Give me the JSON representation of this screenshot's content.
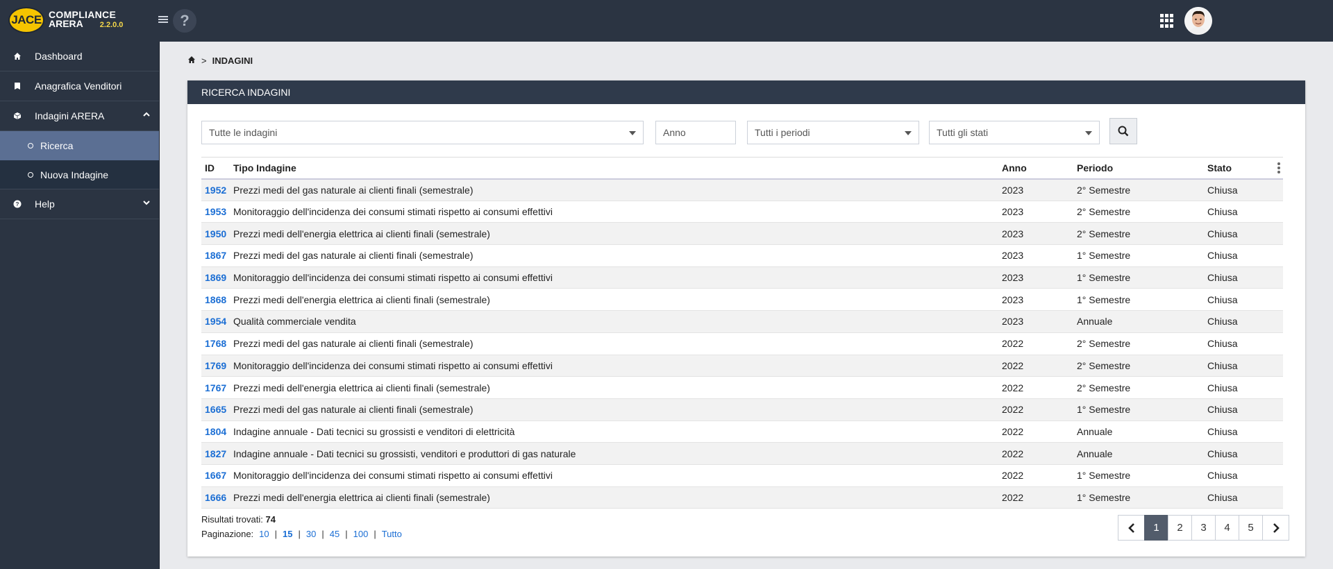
{
  "app": {
    "logo_badge": "JACE",
    "logo_line1": "COMPLIANCE",
    "logo_line2": "ARERA",
    "version": "2.2.0.0"
  },
  "topbar": {
    "help_glyph": "?",
    "menu_icon": "hamburger-icon",
    "apps_icon": "grid-icon"
  },
  "sidebar": {
    "items": [
      {
        "label": "Dashboard",
        "icon": "home-icon"
      },
      {
        "label": "Anagrafica Venditori",
        "icon": "book-icon"
      },
      {
        "label": "Indagini ARERA",
        "icon": "box-icon",
        "expanded": true
      },
      {
        "label": "Help",
        "icon": "question-icon",
        "expanded": false
      }
    ],
    "subitems": [
      {
        "label": "Ricerca",
        "active": true
      },
      {
        "label": "Nuova Indagine",
        "active": false
      }
    ]
  },
  "breadcrumb": {
    "separator": ">",
    "current": "INDAGINI"
  },
  "panel": {
    "title": "RICERCA INDAGINI"
  },
  "filters": {
    "tipo_selected": "Tutte le indagini",
    "anno_placeholder": "Anno",
    "periodo_selected": "Tutti i periodi",
    "stato_selected": "Tutti gli stati"
  },
  "table": {
    "columns": [
      "ID",
      "Tipo Indagine",
      "Anno",
      "Periodo",
      "Stato"
    ],
    "rows": [
      [
        "1952",
        "Prezzi medi del gas naturale ai clienti finali (semestrale)",
        "2023",
        "2° Semestre",
        "Chiusa"
      ],
      [
        "1953",
        "Monitoraggio dell'incidenza dei consumi stimati rispetto ai consumi effettivi",
        "2023",
        "2° Semestre",
        "Chiusa"
      ],
      [
        "1950",
        "Prezzi medi dell'energia elettrica ai clienti finali (semestrale)",
        "2023",
        "2° Semestre",
        "Chiusa"
      ],
      [
        "1867",
        "Prezzi medi del gas naturale ai clienti finali (semestrale)",
        "2023",
        "1° Semestre",
        "Chiusa"
      ],
      [
        "1869",
        "Monitoraggio dell'incidenza dei consumi stimati rispetto ai consumi effettivi",
        "2023",
        "1° Semestre",
        "Chiusa"
      ],
      [
        "1868",
        "Prezzi medi dell'energia elettrica ai clienti finali (semestrale)",
        "2023",
        "1° Semestre",
        "Chiusa"
      ],
      [
        "1954",
        "Qualità commerciale vendita",
        "2023",
        "Annuale",
        "Chiusa"
      ],
      [
        "1768",
        "Prezzi medi del gas naturale ai clienti finali (semestrale)",
        "2022",
        "2° Semestre",
        "Chiusa"
      ],
      [
        "1769",
        "Monitoraggio dell'incidenza dei consumi stimati rispetto ai consumi effettivi",
        "2022",
        "2° Semestre",
        "Chiusa"
      ],
      [
        "1767",
        "Prezzi medi dell'energia elettrica ai clienti finali (semestrale)",
        "2022",
        "2° Semestre",
        "Chiusa"
      ],
      [
        "1665",
        "Prezzi medi del gas naturale ai clienti finali (semestrale)",
        "2022",
        "1° Semestre",
        "Chiusa"
      ],
      [
        "1804",
        "Indagine annuale - Dati tecnici su grossisti e venditori di elettricità",
        "2022",
        "Annuale",
        "Chiusa"
      ],
      [
        "1827",
        "Indagine annuale - Dati tecnici su grossisti, venditori e produttori di gas naturale",
        "2022",
        "Annuale",
        "Chiusa"
      ],
      [
        "1667",
        "Monitoraggio dell'incidenza dei consumi stimati rispetto ai consumi effettivi",
        "2022",
        "1° Semestre",
        "Chiusa"
      ],
      [
        "1666",
        "Prezzi medi dell'energia elettrica ai clienti finali (semestrale)",
        "2022",
        "1° Semestre",
        "Chiusa"
      ]
    ]
  },
  "footer": {
    "results_label": "Risultati trovati:",
    "results_count": "74",
    "pagesize_label": "Paginazione:",
    "pagesize_options": [
      "10",
      "15",
      "30",
      "45",
      "100",
      "Tutto"
    ],
    "pagesize_active": "15",
    "pages": [
      "1",
      "2",
      "3",
      "4",
      "5"
    ],
    "current_page": "1"
  }
}
